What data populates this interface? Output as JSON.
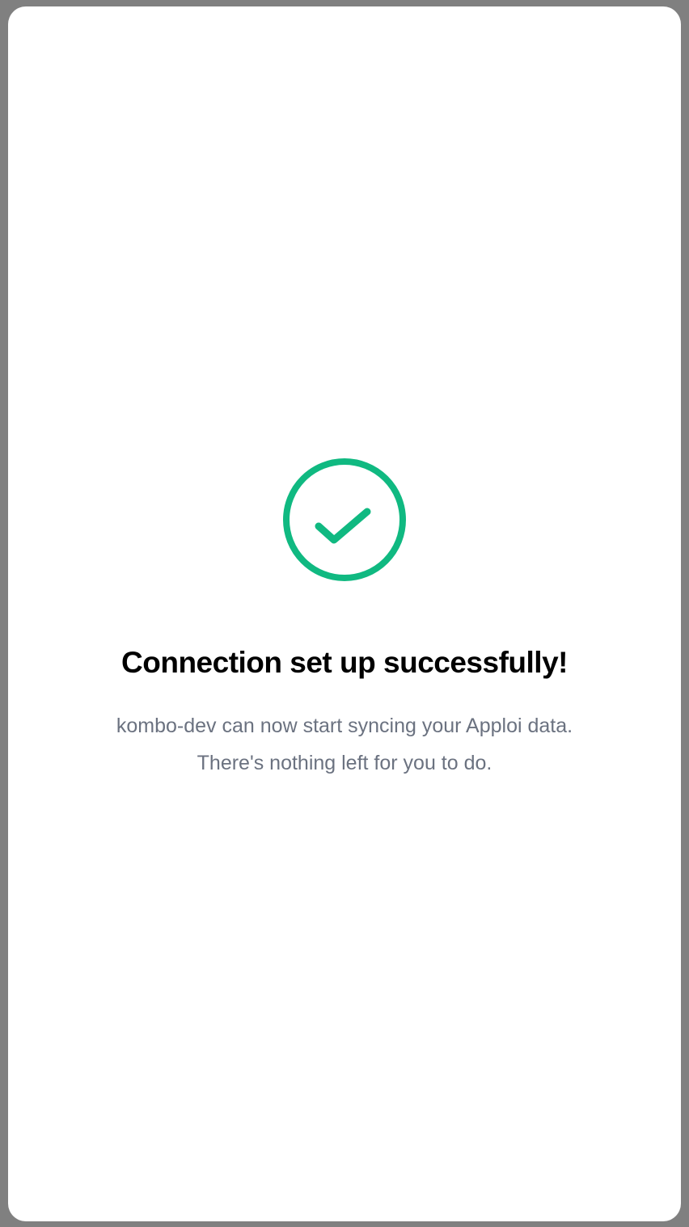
{
  "colors": {
    "backdrop": "#808080",
    "card_background": "#ffffff",
    "success_green": "#10b981",
    "title_color": "#000000",
    "subtitle_color": "#6b7280"
  },
  "icon": {
    "name": "check-circle-icon"
  },
  "message": {
    "title": "Connection set up successfully!",
    "line1": "kombo-dev can now start syncing your Apploi data.",
    "line2": "There's nothing left for you to do."
  }
}
